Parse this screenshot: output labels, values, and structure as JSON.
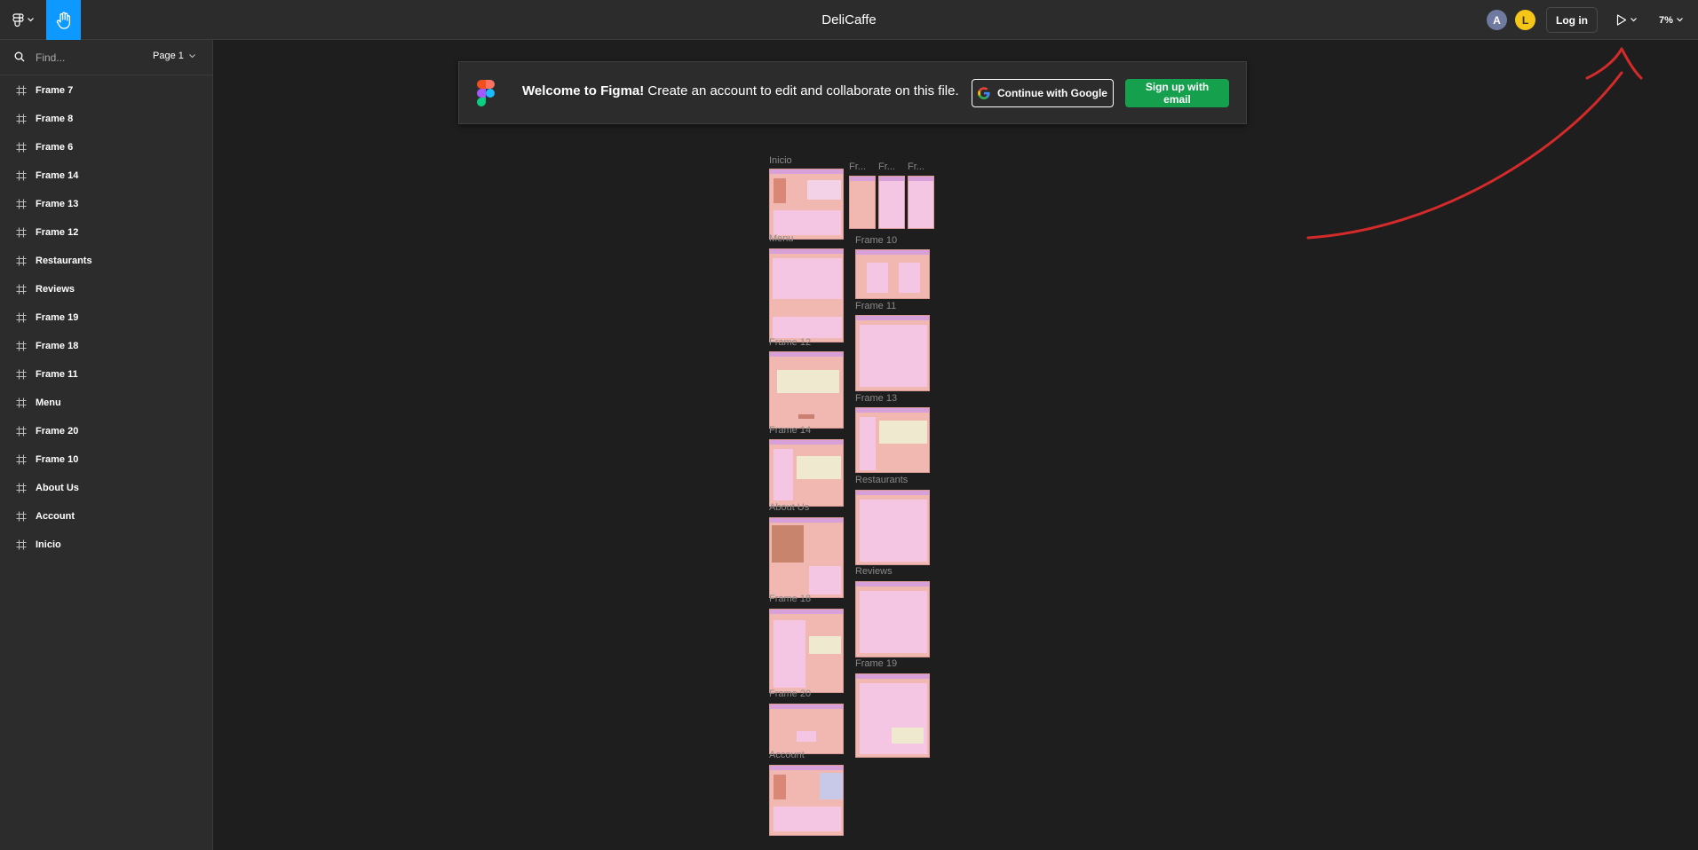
{
  "topbar": {
    "file_title": "DeliCaffe",
    "avatars": [
      "A",
      "L"
    ],
    "login_label": "Log in",
    "zoom_label": "7%"
  },
  "sidebar": {
    "search_placeholder": "Find...",
    "page_label": "Page 1",
    "layers": [
      "Frame 7",
      "Frame 8",
      "Frame 6",
      "Frame 14",
      "Frame 13",
      "Frame 12",
      "Restaurants",
      "Reviews",
      "Frame 19",
      "Frame 18",
      "Frame 11",
      "Menu",
      "Frame 20",
      "Frame 10",
      "About Us",
      "Account",
      "Inicio"
    ]
  },
  "banner": {
    "welcome_bold": "Welcome to Figma!",
    "welcome_rest": " Create an account to edit and collaborate on this file.",
    "google_label": "Continue with Google",
    "signup_label": "Sign up with email"
  },
  "canvas": {
    "labels": {
      "inicio": "Inicio",
      "fr_a": "Fr...",
      "fr_b": "Fr...",
      "fr_c": "Fr...",
      "menu": "Menu",
      "frame10": "Frame 10",
      "frame11": "Frame 11",
      "frame12": "Frame 12",
      "frame13": "Frame 13",
      "frame14": "Frame 14",
      "restaurants": "Restaurants",
      "aboutus": "About Us",
      "reviews": "Reviews",
      "frame18": "Frame 18",
      "frame19": "Frame 19",
      "frame20": "Frame 20",
      "account": "Account"
    }
  },
  "colors": {
    "accent_blue": "#0d99ff",
    "signup_green": "#14a04c",
    "annotation_red": "#d42a2a"
  }
}
